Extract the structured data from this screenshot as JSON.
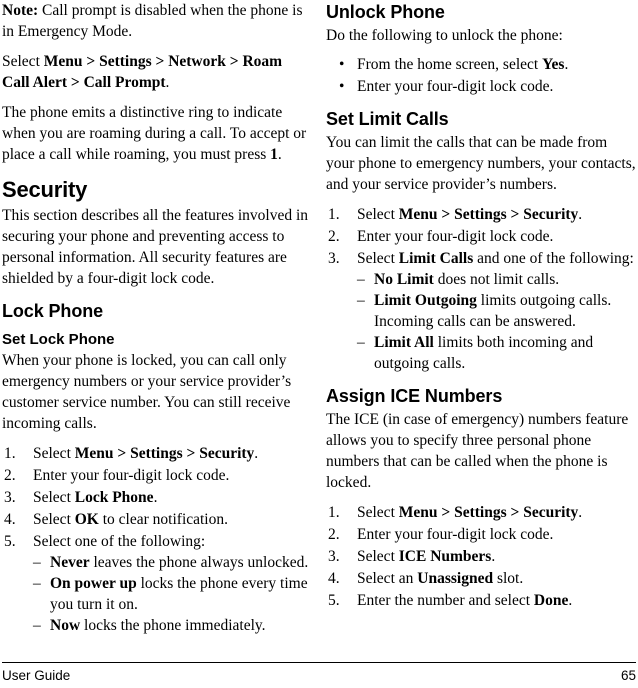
{
  "page": {
    "footer": {
      "left_text": "User Guide",
      "page_number": "65"
    }
  },
  "left_column": {
    "note_paragraph": {
      "label": "Note:",
      "text": " Call prompt is disabled when the phone is in Emergency Mode."
    },
    "select_paragraph": {
      "lead": "Select ",
      "path": "Menu > Settings > Network > Roam Call Alert > Call Prompt",
      "trail": "."
    },
    "roaming_paragraph": {
      "text_before_key": "The phone emits a distinctive ring to indicate when you are roaming during a call. To accept or place a call while roaming, you must press ",
      "key": "1",
      "text_after_key": "."
    },
    "security_heading": "Security",
    "security_intro": "This section describes all the features involved in securing your phone and preventing access to personal information. All security features are shielded by a four-digit lock code.",
    "lock_phone_heading": "Lock Phone",
    "set_lock_phone_heading": "Set Lock Phone",
    "set_lock_phone_intro": "When your phone is locked, you can call only emergency numbers or your service provider’s customer service number. You can still receive incoming calls.",
    "set_lock_phone_steps": [
      {
        "marker": "1.",
        "segments": [
          {
            "text": "Select ",
            "bold": false
          },
          {
            "text": "Menu > Settings > Security",
            "bold": true
          },
          {
            "text": ".",
            "bold": false
          }
        ]
      },
      {
        "marker": "2.",
        "segments": [
          {
            "text": "Enter your four-digit lock code.",
            "bold": false
          }
        ]
      },
      {
        "marker": "3.",
        "segments": [
          {
            "text": "Select ",
            "bold": false
          },
          {
            "text": "Lock Phone",
            "bold": true
          },
          {
            "text": ".",
            "bold": false
          }
        ]
      },
      {
        "marker": "4.",
        "segments": [
          {
            "text": "Select ",
            "bold": false
          },
          {
            "text": "OK",
            "bold": true
          },
          {
            "text": " to clear notification.",
            "bold": false
          }
        ]
      },
      {
        "marker": "5.",
        "segments": [
          {
            "text": "Select one of the following:",
            "bold": false
          }
        ],
        "sub_items": [
          {
            "marker": "–",
            "segments": [
              {
                "text": "Never",
                "bold": true
              },
              {
                "text": " leaves the phone always unlocked.",
                "bold": false
              }
            ]
          },
          {
            "marker": "–",
            "segments": [
              {
                "text": "On power up",
                "bold": true
              },
              {
                "text": " locks the phone every time you turn it on.",
                "bold": false
              }
            ]
          },
          {
            "marker": "–",
            "segments": [
              {
                "text": "Now",
                "bold": true
              },
              {
                "text": " locks the phone immediately.",
                "bold": false
              }
            ]
          }
        ]
      }
    ]
  },
  "right_column": {
    "unlock_phone_heading": "Unlock Phone",
    "unlock_phone_intro": "Do the following to unlock the phone:",
    "unlock_phone_bullets": [
      {
        "marker": "•",
        "segments": [
          {
            "text": "From the home screen, select ",
            "bold": false
          },
          {
            "text": "Yes",
            "bold": true
          },
          {
            "text": ".",
            "bold": false
          }
        ]
      },
      {
        "marker": "•",
        "segments": [
          {
            "text": "Enter your four-digit lock code.",
            "bold": false
          }
        ]
      }
    ],
    "set_limit_calls_heading": "Set Limit Calls",
    "set_limit_calls_intro": "You can limit the calls that can be made from your phone to emergency numbers, your contacts, and your service provider’s numbers.",
    "set_limit_calls_steps": [
      {
        "marker": "1.",
        "segments": [
          {
            "text": "Select ",
            "bold": false
          },
          {
            "text": "Menu > Settings > Security",
            "bold": true
          },
          {
            "text": ".",
            "bold": false
          }
        ]
      },
      {
        "marker": "2.",
        "segments": [
          {
            "text": "Enter your four-digit lock code.",
            "bold": false
          }
        ]
      },
      {
        "marker": "3.",
        "segments": [
          {
            "text": "Select ",
            "bold": false
          },
          {
            "text": "Limit Calls",
            "bold": true
          },
          {
            "text": " and one of the following:",
            "bold": false
          }
        ],
        "sub_items": [
          {
            "marker": "–",
            "segments": [
              {
                "text": "No Limit",
                "bold": true
              },
              {
                "text": " does not limit calls.",
                "bold": false
              }
            ]
          },
          {
            "marker": "–",
            "segments": [
              {
                "text": "Limit Outgoing",
                "bold": true
              },
              {
                "text": " limits outgoing calls. Incoming calls can be answered.",
                "bold": false
              }
            ]
          },
          {
            "marker": "–",
            "segments": [
              {
                "text": "Limit All",
                "bold": true
              },
              {
                "text": " limits both incoming and outgoing calls.",
                "bold": false
              }
            ]
          }
        ]
      }
    ],
    "assign_ice_heading": "Assign ICE Numbers",
    "assign_ice_intro": "The ICE (in case of emergency) numbers feature allows you to specify three personal phone numbers that can be called when the phone is locked.",
    "assign_ice_steps": [
      {
        "marker": "1.",
        "segments": [
          {
            "text": "Select ",
            "bold": false
          },
          {
            "text": "Menu > Settings > Security",
            "bold": true
          },
          {
            "text": ".",
            "bold": false
          }
        ]
      },
      {
        "marker": "2.",
        "segments": [
          {
            "text": "Enter your four-digit lock code.",
            "bold": false
          }
        ]
      },
      {
        "marker": "3.",
        "segments": [
          {
            "text": "Select ",
            "bold": false
          },
          {
            "text": "ICE Numbers",
            "bold": true
          },
          {
            "text": ".",
            "bold": false
          }
        ]
      },
      {
        "marker": "4.",
        "segments": [
          {
            "text": "Select an ",
            "bold": false
          },
          {
            "text": "Unassigned",
            "bold": true
          },
          {
            "text": " slot.",
            "bold": false
          }
        ]
      },
      {
        "marker": "5.",
        "segments": [
          {
            "text": "Enter the number and select ",
            "bold": false
          },
          {
            "text": "Done",
            "bold": true
          },
          {
            "text": ".",
            "bold": false
          }
        ]
      }
    ]
  }
}
